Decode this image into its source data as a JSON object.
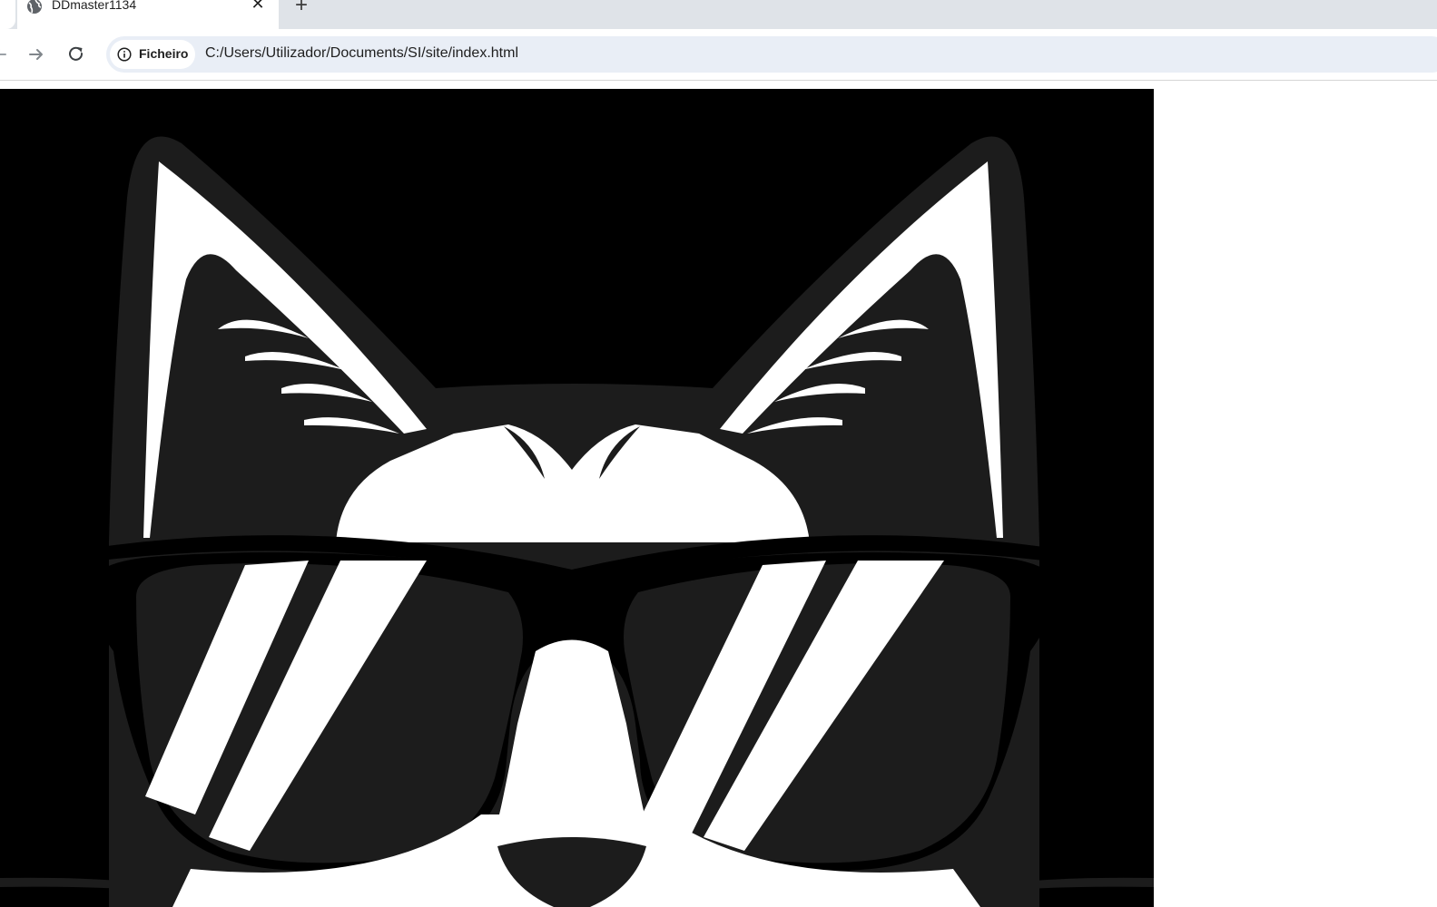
{
  "tab": {
    "title": "DDmaster1134",
    "favicon": "globe-icon",
    "close_icon": "close-icon"
  },
  "new_tab": {
    "icon": "plus-icon"
  },
  "toolbar": {
    "back_icon": "back-arrow-icon",
    "forward_icon": "forward-arrow-icon",
    "reload_icon": "reload-icon"
  },
  "address_bar": {
    "chip_label": "Ficheiro",
    "chip_icon": "info-icon",
    "url": "C:/Users/Utilizador/Documents/SI/site/index.html"
  },
  "page": {
    "image": "cat-with-sunglasses-logo"
  },
  "colors": {
    "tabstrip_bg": "#dfe3e8",
    "omnibox_bg": "#e9eef6",
    "image_bg": "#000000",
    "cat_dark": "#1c1c1c",
    "cat_light": "#ffffff"
  }
}
